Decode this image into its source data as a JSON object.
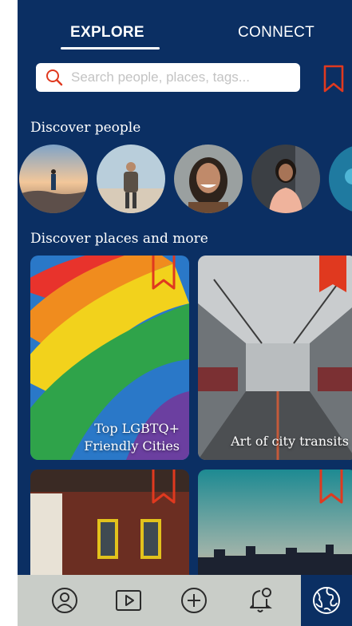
{
  "tabs": [
    {
      "label": "EXPLORE",
      "active": true
    },
    {
      "label": "CONNECT",
      "active": false
    }
  ],
  "search": {
    "placeholder": "Search people, places, tags..."
  },
  "sections": {
    "people_title": "Discover people",
    "places_title": "Discover places and more"
  },
  "cards": [
    {
      "label_line1": "Top LGBTQ+",
      "label_line2": "Friendly Cities"
    },
    {
      "label_line1": "Art of city transits",
      "label_line2": ""
    }
  ],
  "nav": [
    "profile-icon",
    "video-play-icon",
    "add-circle-icon",
    "notification-bell-icon",
    "globe-icon"
  ],
  "colors": {
    "background": "#0b2f63",
    "accent": "#e0391f",
    "nav_bar": "#c9cdc8"
  }
}
